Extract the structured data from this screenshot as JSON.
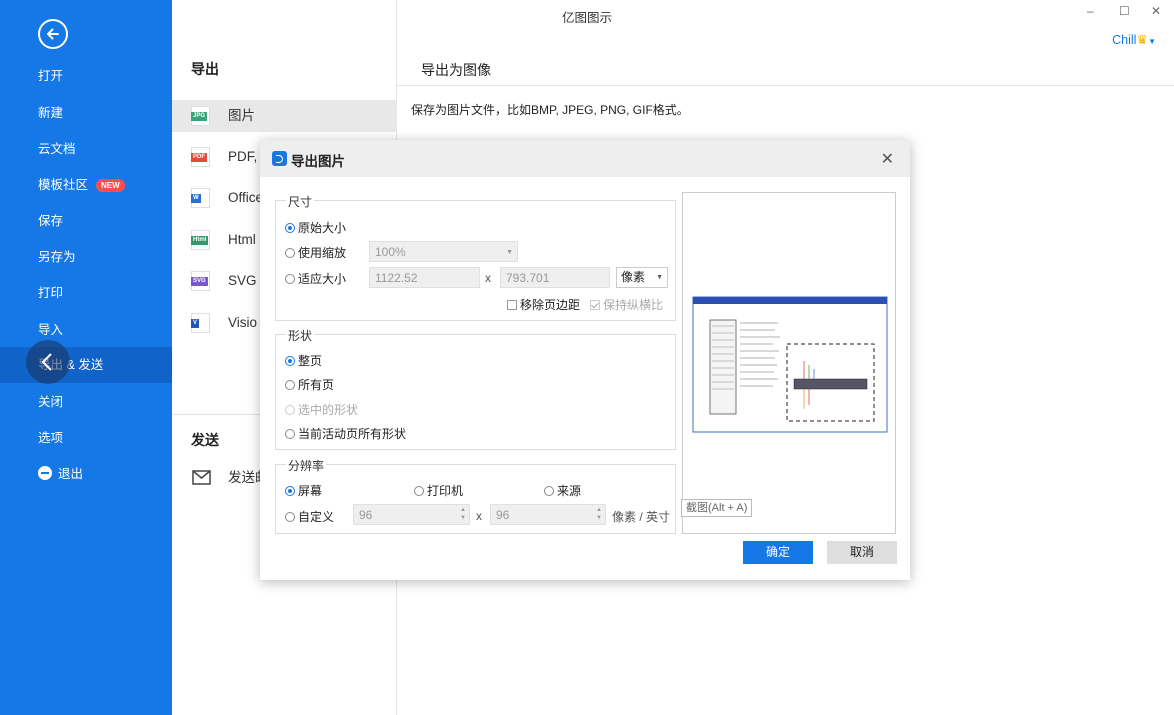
{
  "app_title": "亿图图示",
  "window": {
    "minimize": "–",
    "maximize": "☐",
    "close": "✕"
  },
  "user": {
    "name": "Chill"
  },
  "sidebar": {
    "items": [
      {
        "label": "打开"
      },
      {
        "label": "新建"
      },
      {
        "label": "云文档"
      },
      {
        "label": "模板社区",
        "badge": "NEW"
      },
      {
        "label": "保存"
      },
      {
        "label": "另存为"
      },
      {
        "label": "打印"
      },
      {
        "label": "导入"
      },
      {
        "label": "导出 & 发送"
      },
      {
        "label": "关闭"
      },
      {
        "label": "选项"
      },
      {
        "label": "退出"
      }
    ]
  },
  "export_section": {
    "title": "导出",
    "items": [
      {
        "label": "图片",
        "icon_text": "JPG",
        "icon_color": "#3aa37a"
      },
      {
        "label": "PDF, P",
        "icon_text": "PDF",
        "icon_color": "#e64a3b"
      },
      {
        "label": "Office",
        "icon_text": "W",
        "icon_color": "#2b6fd6"
      },
      {
        "label": "Html",
        "icon_text": "Html",
        "icon_color": "#2f9c6e"
      },
      {
        "label": "SVG",
        "icon_text": "SVG",
        "icon_color": "#7b57c9"
      },
      {
        "label": "Visio",
        "icon_text": "V",
        "icon_color": "#2456b8"
      }
    ]
  },
  "send_section": {
    "title": "发送",
    "items": [
      {
        "label": "发送邮"
      }
    ]
  },
  "right_panel": {
    "title": "导出为图像",
    "description": "保存为图片文件，比如BMP, JPEG, PNG, GIF格式。"
  },
  "dialog": {
    "title": "导出图片",
    "size": {
      "title": "尺寸",
      "opt_original": "原始大小",
      "opt_zoom": "使用缩放",
      "zoom_value": "100%",
      "opt_fit": "适应大小",
      "width": "1122.52",
      "height": "793.701",
      "x": "x",
      "unit": "像素",
      "remove_margin": "移除页边距",
      "keep_ratio": "保持纵横比"
    },
    "shape": {
      "title": "形状",
      "opt_whole": "整页",
      "opt_all_pages": "所有页",
      "opt_selected": "选中的形状",
      "opt_current_all": "当前活动页所有形状"
    },
    "resolution": {
      "title": "分辨率",
      "opt_screen": "屏幕",
      "opt_printer": "打印机",
      "opt_source": "来源",
      "opt_custom": "自定义",
      "dpi_x": "96",
      "dpi_y": "96",
      "x": "x",
      "unit": "像素 / 英寸"
    },
    "tooltip": "截图(Alt + A)",
    "ok": "确定",
    "cancel": "取消"
  }
}
